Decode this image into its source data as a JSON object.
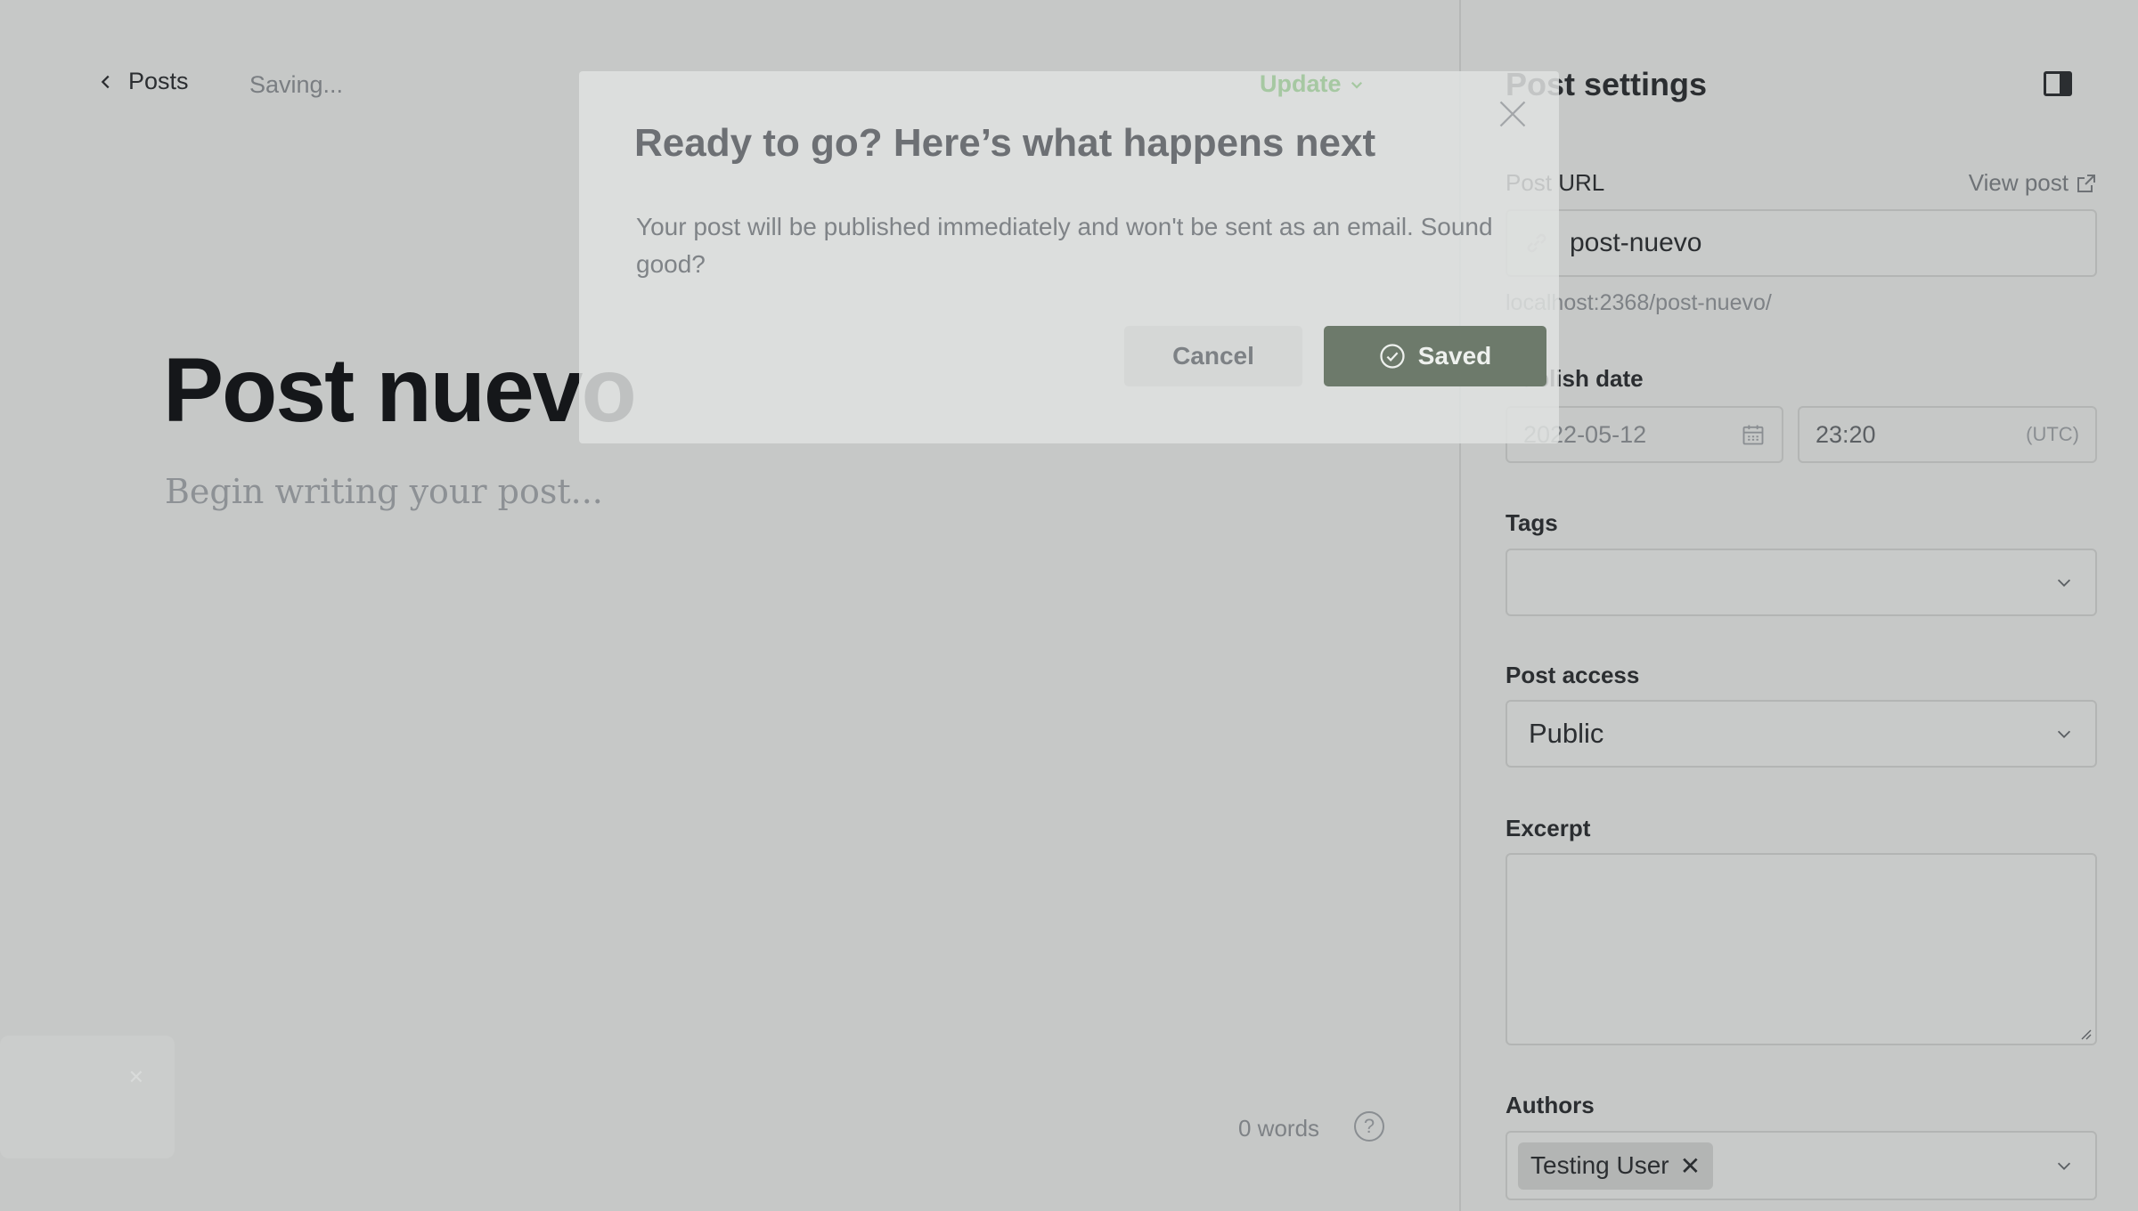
{
  "editor": {
    "back_label": "Posts",
    "status_text": "Saving...",
    "update_label": "Update",
    "post_title": "Post nuevo",
    "body_placeholder": "Begin writing your post...",
    "word_count": "0 words",
    "help_glyph": "?"
  },
  "settings": {
    "title": "Post settings",
    "post_url": {
      "label": "Post URL",
      "view_post_label": "View post",
      "value": "post-nuevo",
      "hint": "localhost:2368/post-nuevo/"
    },
    "publish_date": {
      "label": "Publish date",
      "date": "2022-05-12",
      "time": "23:20",
      "timezone": "(UTC)"
    },
    "tags": {
      "label": "Tags",
      "value": ""
    },
    "post_access": {
      "label": "Post access",
      "value": "Public"
    },
    "excerpt": {
      "label": "Excerpt",
      "value": ""
    },
    "authors": {
      "label": "Authors",
      "items": [
        "Testing User"
      ]
    }
  },
  "modal": {
    "title": "Ready to go? Here’s what happens next",
    "text": "Your post will be published immediately and won't be sent as an email. Sound good?",
    "cancel_label": "Cancel",
    "confirm_label": "Saved"
  },
  "icons": {
    "back": "chevron-left-icon",
    "update_caret": "chevron-down-icon",
    "panel_toggle": "sidebar-toggle-icon",
    "view_post": "external-link-icon",
    "url": "link-icon",
    "date": "calendar-icon",
    "select": "chevron-down-icon",
    "modal_close": "close-icon",
    "confirm": "check-circle-icon",
    "chip_remove": "close-icon"
  },
  "colors": {
    "overlay_bg": "#c6c8c7",
    "update_accent": "#a6c8a2",
    "saved_button_bg": "#6d7a6b"
  }
}
